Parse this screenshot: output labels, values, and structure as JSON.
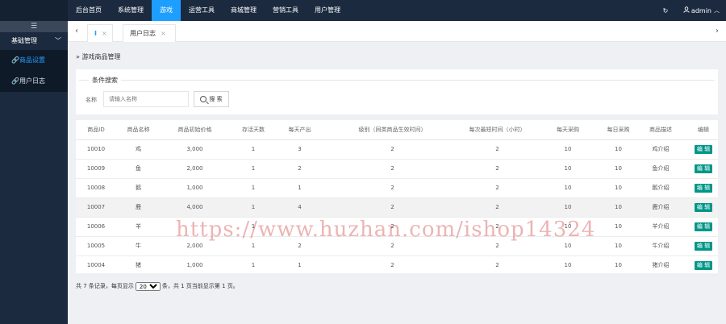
{
  "topnav": {
    "items": [
      {
        "label": "后台首页",
        "active": false
      },
      {
        "label": "系统管理",
        "active": false
      },
      {
        "label": "游戏",
        "active": true
      },
      {
        "label": "运营工具",
        "active": false
      },
      {
        "label": "商城管理",
        "active": false
      },
      {
        "label": "营销工具",
        "active": false
      },
      {
        "label": "用户管理",
        "active": false
      }
    ],
    "user": "admin"
  },
  "sidebar": {
    "toggle": "☰",
    "group": "基础管理",
    "items": [
      {
        "label": "商品设置",
        "active": true
      },
      {
        "label": "用户日志",
        "active": false
      }
    ]
  },
  "tabs": [
    {
      "label": "I",
      "close": "×"
    },
    {
      "label": "用户日志",
      "close": "×"
    }
  ],
  "breadcrumb": "游戏商品管理",
  "search": {
    "legend": "条件搜索",
    "label": "名称",
    "placeholder": "请输入名称",
    "button": "搜 索"
  },
  "table": {
    "columns": [
      "商品ID",
      "商品名称",
      "商品初始价格",
      "存活天数",
      "每天产出",
      "级别（同类商品生效时间）",
      "每次最短时间（小时）",
      "每天采购",
      "每日采购",
      "商品描述",
      "编辑"
    ],
    "rows": [
      {
        "id": "10010",
        "name": "鸡",
        "price": "3,000",
        "days": "1",
        "daily": "3",
        "level": "2",
        "hours": "2",
        "buy_day": "10",
        "buy_daily": "10",
        "desc": "鸡介绍"
      },
      {
        "id": "10009",
        "name": "鱼",
        "price": "2,000",
        "days": "1",
        "daily": "2",
        "level": "2",
        "hours": "2",
        "buy_day": "10",
        "buy_daily": "10",
        "desc": "鱼介绍"
      },
      {
        "id": "10008",
        "name": "鹅",
        "price": "1,000",
        "days": "1",
        "daily": "1",
        "level": "2",
        "hours": "2",
        "buy_day": "10",
        "buy_daily": "10",
        "desc": "鹅介绍"
      },
      {
        "id": "10007",
        "name": "鹿",
        "price": "4,000",
        "days": "1",
        "daily": "4",
        "level": "2",
        "hours": "2",
        "buy_day": "10",
        "buy_daily": "10",
        "desc": "鹿介绍"
      },
      {
        "id": "10006",
        "name": "羊",
        "price": "",
        "days": "1",
        "daily": "",
        "level": "2",
        "hours": "2",
        "buy_day": "10",
        "buy_daily": "10",
        "desc": "羊介绍"
      },
      {
        "id": "10005",
        "name": "牛",
        "price": "2,000",
        "days": "1",
        "daily": "2",
        "level": "2",
        "hours": "2",
        "buy_day": "10",
        "buy_daily": "10",
        "desc": "牛介绍"
      },
      {
        "id": "10004",
        "name": "猪",
        "price": "1,000",
        "days": "1",
        "daily": "1",
        "level": "2",
        "hours": "2",
        "buy_day": "10",
        "buy_daily": "10",
        "desc": "猪介绍"
      }
    ],
    "edit_label": "编 辑",
    "highlight_index": 3
  },
  "pager": {
    "prefix": "共 7 条记录，每页显示",
    "page_size": "20",
    "suffix": "条，共 1 页当前显示第 1 页。"
  },
  "watermark": "https://www.huzhan.com/ishop14324",
  "colors": {
    "accent": "#1e9fff",
    "edit": "#009688",
    "nav_bg": "#1b2a3f"
  }
}
